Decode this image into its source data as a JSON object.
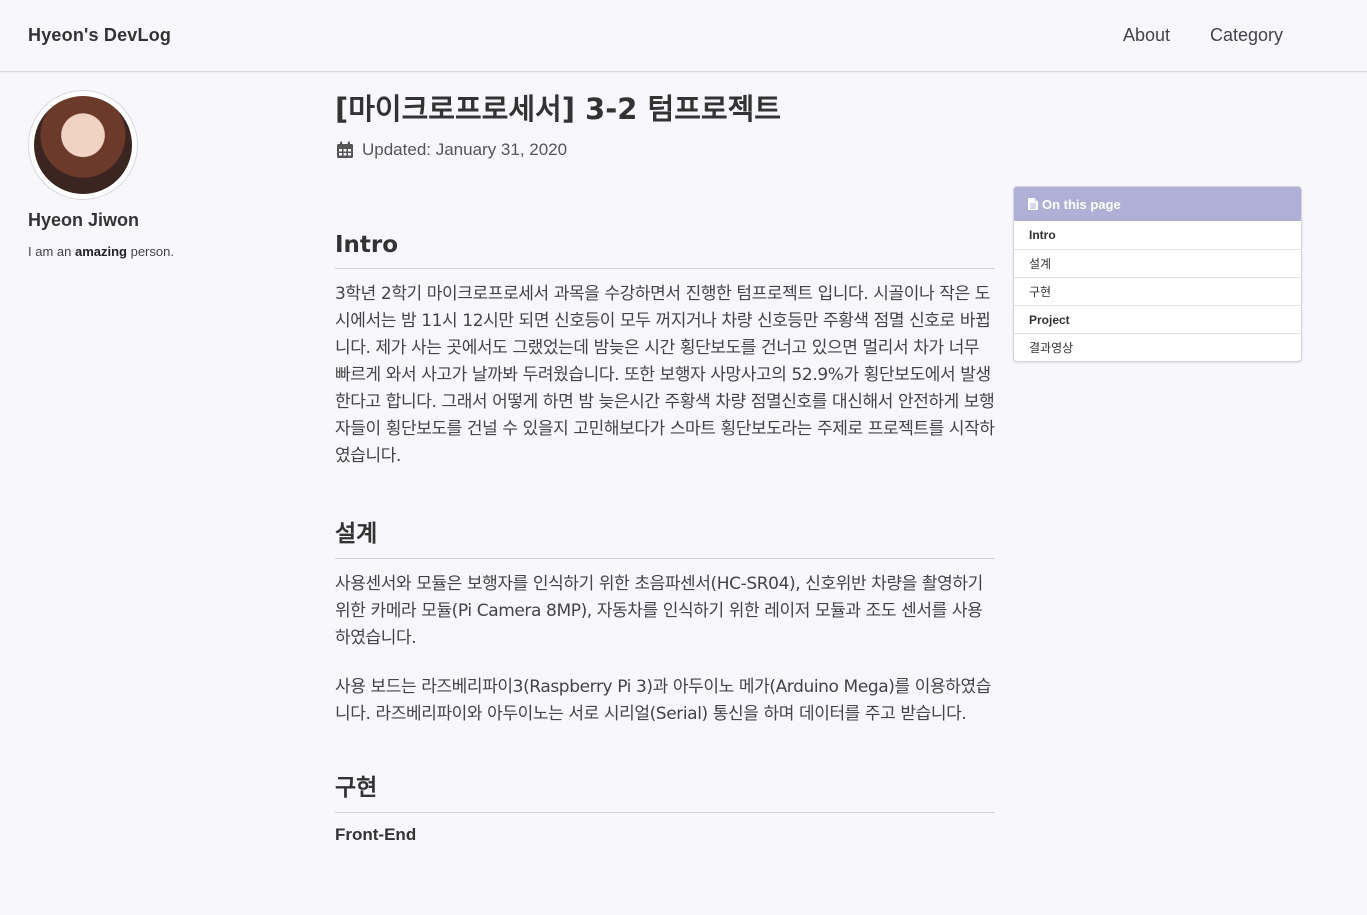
{
  "masthead": {
    "site_title": "Hyeon's DevLog",
    "nav": [
      "About",
      "Category"
    ]
  },
  "author": {
    "name": "Hyeon Jiwon",
    "bio_prefix": "I am an ",
    "bio_bold": "amazing",
    "bio_suffix": " person."
  },
  "page": {
    "title": "[마이크로프로세서] 3-2 텀프로젝트",
    "updated": "Updated: January 31, 2020"
  },
  "content": {
    "intro": {
      "heading": "Intro",
      "paragraph": "3학년 2학기 마이크로프로세서 과목을 수강하면서 진행한 텀프로젝트 입니다. 시골이나 작은 도시에서는 밤 11시 12시만 되면 신호등이 모두 꺼지거나 차량 신호등만 주황색 점멸 신호로 바뀝니다. 제가 사는 곳에서도 그랬었는데 밤늦은 시간 횡단보도를 건너고 있으면 멀리서 차가 너무 빠르게 와서 사고가 날까봐 두려웠습니다. 또한 보행자 사망사고의 52.9%가 횡단보도에서 발생한다고 합니다. 그래서 어떻게 하면 밤 늦은시간 주황색 차량 점멸신호를 대신해서 안전하게 보행자들이 횡단보도를 건널 수 있을지 고민해보다가 스마트 횡단보도라는 주제로 프로젝트를 시작하였습니다."
    },
    "design": {
      "heading": "설계",
      "paragraph1": "사용센서와 모듈은 보행자를 인식하기 위한 초음파센서(HC-SR04), 신호위반 차량을 촬영하기 위한 카메라 모듈(Pi Camera 8MP), 자동차를 인식하기 위한 레이저 모듈과 조도 센서를 사용하였습니다.",
      "paragraph2": "사용 보드는 라즈베리파이3(Raspberry Pi 3)과 아두이노 메가(Arduino Mega)를 이용하였습니다. 라즈베리파이와 아두이노는 서로 시리얼(Serial) 통신을 하며 데이터를 주고 받습니다."
    },
    "impl": {
      "heading": "구현",
      "subheading": "Front-End"
    }
  },
  "toc": {
    "title": "On this page",
    "items": [
      {
        "label": "Intro",
        "bold": true
      },
      {
        "label": "설계",
        "bold": false
      },
      {
        "label": "구현",
        "bold": false
      },
      {
        "label": "Project",
        "bold": true
      },
      {
        "label": "결과영상",
        "bold": false
      }
    ]
  },
  "icons": {
    "calendar": "calendar-icon",
    "toc": "file-text-icon"
  },
  "colors": {
    "background": "#f8f8fc",
    "toc_header": "#b0b0d6",
    "text": "#333333"
  }
}
